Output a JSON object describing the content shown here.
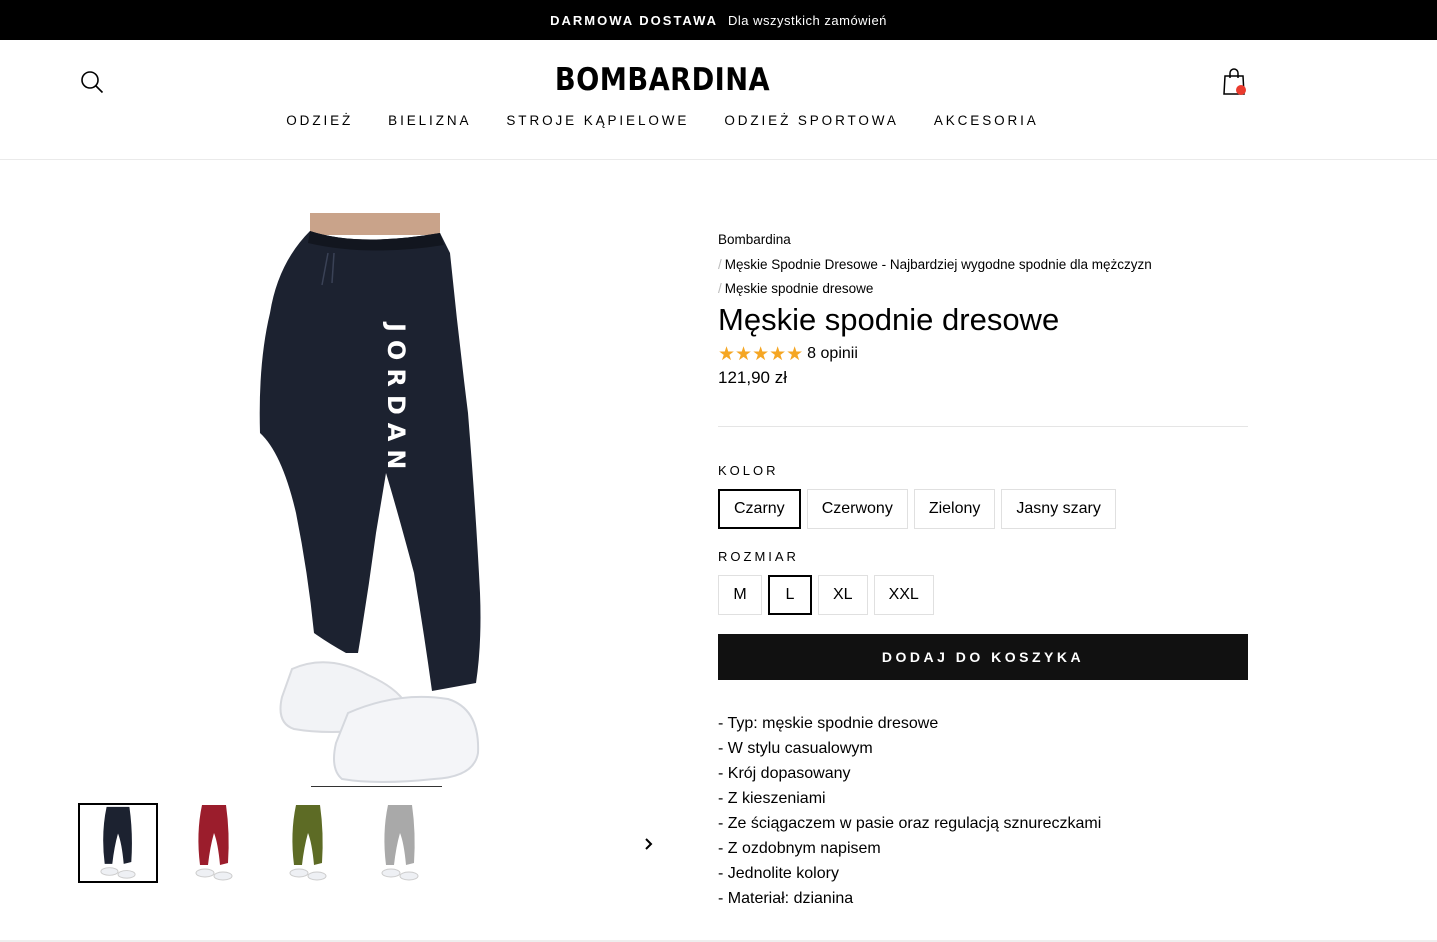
{
  "announcement": {
    "strong": "DARMOWA DOSTAWA",
    "text": "Dla wszystkich zamówień"
  },
  "header": {
    "logo": "BOMBARDINA",
    "nav": [
      "ODZIEŻ",
      "BIELIZNA",
      "STROJE KĄPIELOWE",
      "ODZIEŻ SPORTOWA",
      "AKCESORIA"
    ]
  },
  "gallery": {
    "main_print": "JORDAN",
    "thumbnails": [
      {
        "color": "#1c2230"
      },
      {
        "color": "#9b1d2c"
      },
      {
        "color": "#5d6b25"
      },
      {
        "color": "#a9a9a9"
      }
    ]
  },
  "product": {
    "breadcrumb": [
      "Bombardina",
      "Męskie Spodnie Dresowe - Najbardziej wygodne spodnie dla mężczyzn",
      "Męskie spodnie dresowe"
    ],
    "title": "Męskie spodnie dresowe",
    "stars": "★★★★★",
    "reviews": "8 opinii",
    "price": "121,90 zł",
    "color_label": "KOLOR",
    "colors": [
      "Czarny",
      "Czerwony",
      "Zielony",
      "Jasny szary"
    ],
    "size_label": "ROZMIAR",
    "sizes": [
      "M",
      "L",
      "XL",
      "XXL"
    ],
    "add_to_cart": "DODAJ DO KOSZYKA",
    "description": [
      "- Typ: męskie spodnie dresowe",
      "- W stylu casualowym",
      "- Krój dopasowany",
      "- Z kieszeniami",
      "- Ze ściągaczem w pasie oraz regulacją sznureczkami",
      "- Z ozdobnym napisem",
      "- Jednolite kolory",
      "- Materiał: dzianina"
    ]
  },
  "colors": {
    "accent": "#f5a623",
    "cart_badge": "#ea3b2e",
    "button": "#111111"
  }
}
